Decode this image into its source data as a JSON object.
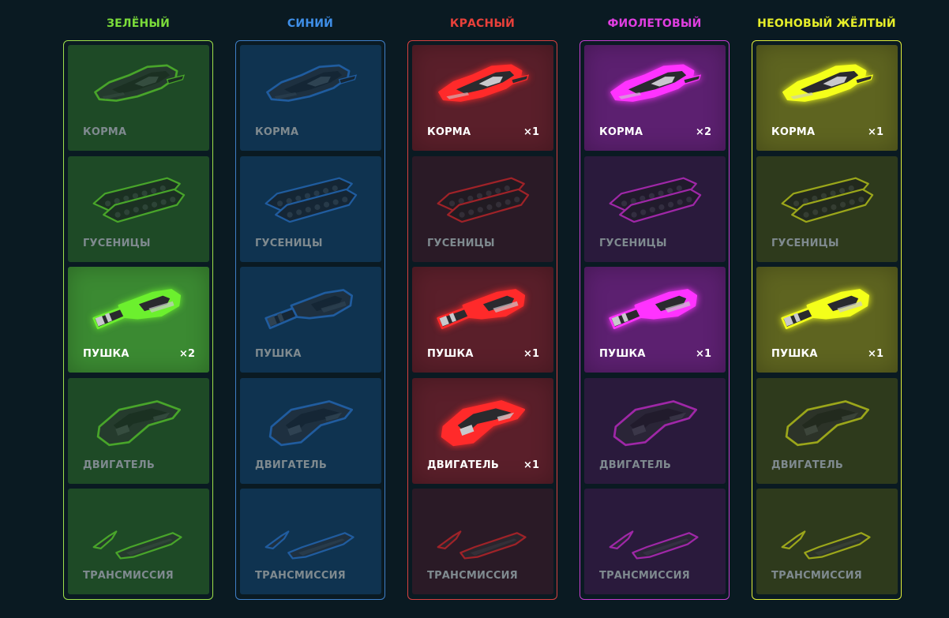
{
  "columns": [
    {
      "title": "ЗЕЛЁНЫЙ",
      "color": "#7bdc3a",
      "border": "#9ee04a",
      "card_off": "#1e4a26",
      "card_on": "#3b8a32",
      "glow": "#6cf02e",
      "items": [
        {
          "part": "hull",
          "label": "КОРМА",
          "count": "",
          "owned": false
        },
        {
          "part": "tracks",
          "label": "ГУСЕНИЦЫ",
          "count": "",
          "owned": false
        },
        {
          "part": "gun",
          "label": "ПУШКА",
          "count": "×2",
          "owned": true
        },
        {
          "part": "engine",
          "label": "ДВИГАТЕЛЬ",
          "count": "",
          "owned": false
        },
        {
          "part": "transmission",
          "label": "ТРАНСМИССИЯ",
          "count": "",
          "owned": false
        }
      ]
    },
    {
      "title": "СИНИЙ",
      "color": "#3f8fe8",
      "border": "#3f7fc8",
      "card_off": "#0f3350",
      "card_on": "#1c5a92",
      "glow": "#2f7fe0",
      "items": [
        {
          "part": "hull",
          "label": "КОРМА",
          "count": "",
          "owned": false
        },
        {
          "part": "tracks",
          "label": "ГУСЕНИЦЫ",
          "count": "",
          "owned": false
        },
        {
          "part": "gun",
          "label": "ПУШКА",
          "count": "",
          "owned": false
        },
        {
          "part": "engine",
          "label": "ДВИГАТЕЛЬ",
          "count": "",
          "owned": false
        },
        {
          "part": "transmission",
          "label": "ТРАНСМИССИЯ",
          "count": "",
          "owned": false
        }
      ]
    },
    {
      "title": "КРАСНЫЙ",
      "color": "#e8403a",
      "border": "#d8403f",
      "card_off": "#2a1a26",
      "card_on": "#5a1f2a",
      "glow": "#ff2a2a",
      "items": [
        {
          "part": "hull",
          "label": "КОРМА",
          "count": "×1",
          "owned": true
        },
        {
          "part": "tracks",
          "label": "ГУСЕНИЦЫ",
          "count": "",
          "owned": false
        },
        {
          "part": "gun",
          "label": "ПУШКА",
          "count": "×1",
          "owned": true
        },
        {
          "part": "engine",
          "label": "ДВИГАТЕЛЬ",
          "count": "×1",
          "owned": true
        },
        {
          "part": "transmission",
          "label": "ТРАНСМИССИЯ",
          "count": "",
          "owned": false
        }
      ]
    },
    {
      "title": "ФИОЛЕТОВЫЙ",
      "color": "#e03ee0",
      "border": "#c43ed0",
      "card_off": "#2a1a3c",
      "card_on": "#5c2070",
      "glow": "#ff33ff",
      "items": [
        {
          "part": "hull",
          "label": "КОРМА",
          "count": "×2",
          "owned": true
        },
        {
          "part": "tracks",
          "label": "ГУСЕНИЦЫ",
          "count": "",
          "owned": false
        },
        {
          "part": "gun",
          "label": "ПУШКА",
          "count": "×1",
          "owned": true
        },
        {
          "part": "engine",
          "label": "ДВИГАТЕЛЬ",
          "count": "",
          "owned": false
        },
        {
          "part": "transmission",
          "label": "ТРАНСМИССИЯ",
          "count": "",
          "owned": false
        }
      ]
    },
    {
      "title": "НЕОНОВЫЙ ЖЁЛТЫЙ",
      "color": "#e6ee2a",
      "border": "#e0ee3a",
      "card_off": "#2e3a1c",
      "card_on": "#5e6420",
      "glow": "#f4ff1a",
      "items": [
        {
          "part": "hull",
          "label": "КОРМА",
          "count": "×1",
          "owned": true
        },
        {
          "part": "tracks",
          "label": "ГУСЕНИЦЫ",
          "count": "",
          "owned": false
        },
        {
          "part": "gun",
          "label": "ПУШКА",
          "count": "×1",
          "owned": true
        },
        {
          "part": "engine",
          "label": "ДВИГАТЕЛЬ",
          "count": "",
          "owned": false
        },
        {
          "part": "transmission",
          "label": "ТРАНСМИССИЯ",
          "count": "",
          "owned": false
        }
      ]
    }
  ]
}
